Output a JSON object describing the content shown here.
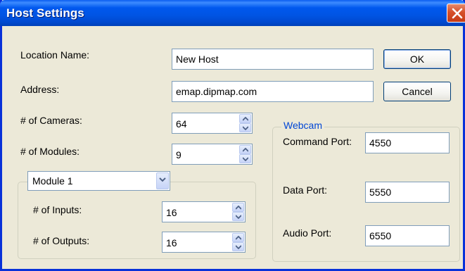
{
  "window": {
    "title": "Host Settings"
  },
  "fields": {
    "location_name": {
      "label": "Location Name:",
      "value": "New Host"
    },
    "address": {
      "label": "Address:",
      "value": "emap.dipmap.com"
    },
    "cameras": {
      "label": "# of Cameras:",
      "value": "64"
    },
    "modules": {
      "label": "# of Modules:",
      "value": "9"
    }
  },
  "buttons": {
    "ok": "OK",
    "cancel": "Cancel"
  },
  "module_group": {
    "selected_module": "Module 1",
    "inputs": {
      "label": "# of Inputs:",
      "value": "16"
    },
    "outputs": {
      "label": "# of Outputs:",
      "value": "16"
    }
  },
  "webcam": {
    "title": "Webcam",
    "command_port": {
      "label": "Command Port:",
      "value": "4550"
    },
    "data_port": {
      "label": "Data Port:",
      "value": "5550"
    },
    "audio_port": {
      "label": "Audio Port:",
      "value": "6550"
    }
  },
  "icons": {
    "close": "close-icon",
    "spin_up": "spin-up-arrow-icon",
    "spin_down": "spin-down-arrow-icon",
    "dropdown": "chevron-down-icon"
  },
  "colors": {
    "titlebar": "#0054E3",
    "window_bg": "#ECE9D8",
    "group_title": "#0046D5",
    "close": "#D6502A"
  }
}
